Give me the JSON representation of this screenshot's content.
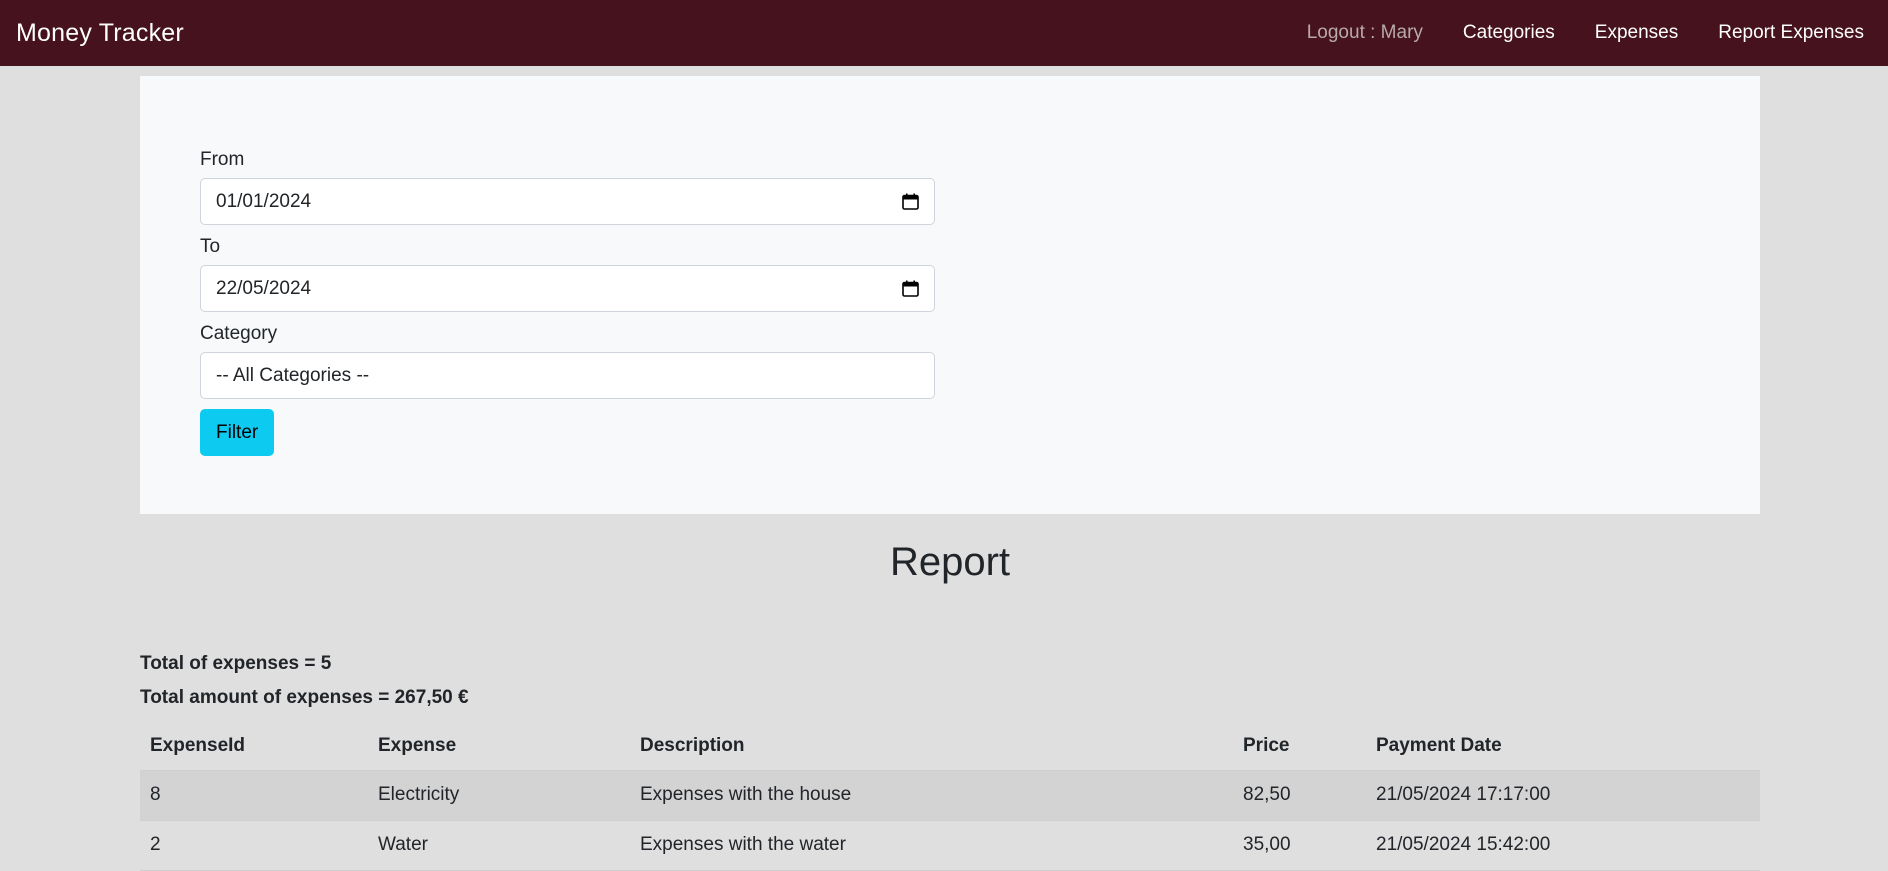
{
  "navbar": {
    "brand": "Money Tracker",
    "links": [
      "Logout : Mary",
      "Categories",
      "Expenses",
      "Report Expenses"
    ]
  },
  "filter": {
    "from_label": "From",
    "from_value": "01/01/2024",
    "to_label": "To",
    "to_value": "22/05/2024",
    "category_label": "Category",
    "category_value": "-- All Categories --",
    "button_label": "Filter"
  },
  "report": {
    "title": "Report",
    "total_count_text": "Total of expenses = 5",
    "total_amount_text": "Total amount of expenses = 267,50 €",
    "columns": [
      "ExpenseId",
      "Expense",
      "Description",
      "Price",
      "Payment Date"
    ],
    "rows": [
      [
        "8",
        "Electricity",
        "Expenses with the house",
        "82,50",
        "21/05/2024 17:17:00"
      ],
      [
        "2",
        "Water",
        "Expenses with the water",
        "35,00",
        "21/05/2024 15:42:00"
      ]
    ]
  },
  "colors": {
    "navbar": "#45121d",
    "filter_button": "#0dcaf0",
    "page_background": "#dfdfdf"
  },
  "icons": {
    "date_picker": "calendar-icon"
  }
}
